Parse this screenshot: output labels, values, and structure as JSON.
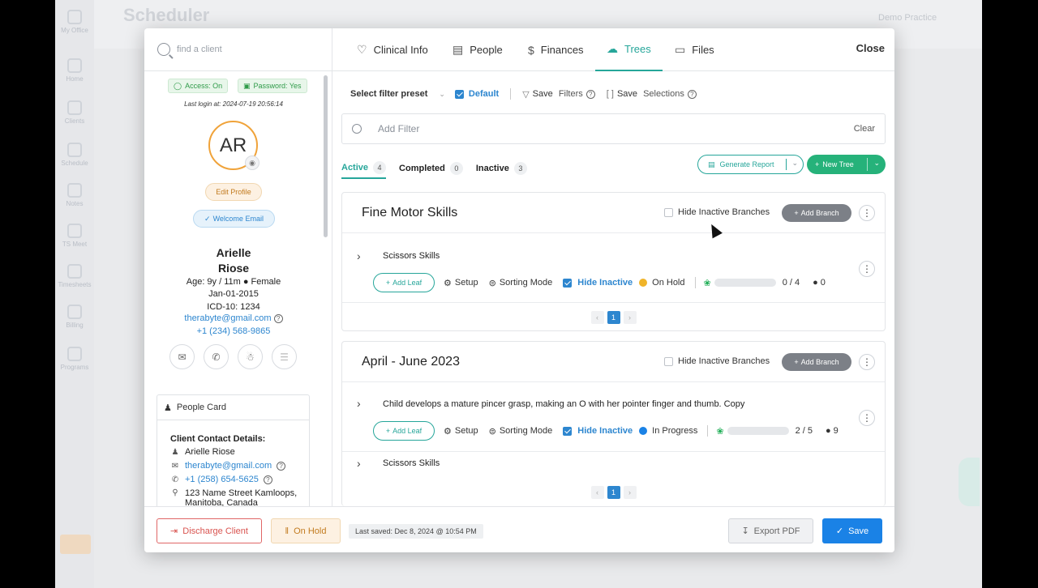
{
  "background": {
    "app_title": "Scheduler",
    "my_office": "My Office",
    "nav": [
      "Home",
      "Clients",
      "Schedule",
      "Notes",
      "TS Meet",
      "Timesheets",
      "Billing",
      "Programs"
    ],
    "practice": "Demo Practice"
  },
  "search": {
    "placeholder": "find a client"
  },
  "tabs": [
    {
      "label": "Clinical Info",
      "icon": "heart-icon"
    },
    {
      "label": "People",
      "icon": "id-card-icon"
    },
    {
      "label": "Finances",
      "icon": "dollar-icon"
    },
    {
      "label": "Trees",
      "icon": "tree-icon"
    },
    {
      "label": "Files",
      "icon": "folder-icon"
    }
  ],
  "close_label": "Close",
  "client": {
    "access": "Access: On",
    "password": "Password: Yes",
    "last_login": "Last login at: 2024-07-19 20:56:14",
    "initials": "AR",
    "edit_profile": "Edit Profile",
    "welcome_email": "Welcome Email",
    "first_name": "Arielle",
    "last_name": "Riose",
    "age_gender": "Age: 9y / 11m ● Female",
    "dob": "Jan-01-2015",
    "icd": "ICD-10: 1234",
    "email": "therabyte@gmail.com",
    "phone": "+1 (234) 568-9865"
  },
  "people_card": {
    "title": "People Card",
    "contact_title": "Client Contact Details:",
    "name": "Arielle Riose",
    "email": "therabyte@gmail.com",
    "phone": "+1 (258) 654-5625",
    "address": "123 Name Street Kamloops,",
    "address2": "Manitoba, Canada"
  },
  "filters": {
    "preset_label": "Select filter preset",
    "default_label": "Default",
    "save_label": "Save",
    "filters_label": "Filters",
    "selections_label": "Selections",
    "add_filter_placeholder": "Add Filter",
    "clear_label": "Clear"
  },
  "subtabs": [
    {
      "label": "Active",
      "count": "4"
    },
    {
      "label": "Completed",
      "count": "0"
    },
    {
      "label": "Inactive",
      "count": "3"
    }
  ],
  "actions": {
    "generate_report": "Generate Report",
    "new_tree": "New Tree"
  },
  "trees": [
    {
      "title": "Fine Motor Skills",
      "hide_inactive_branches": "Hide Inactive Branches",
      "add_branch": "Add Branch",
      "branch": {
        "name": "Scissors Skills",
        "add_leaf": "Add Leaf",
        "setup": "Setup",
        "sorting_mode": "Sorting Mode",
        "hide_inactive": "Hide Inactive",
        "status": "On Hold",
        "status_color": "#f0b429",
        "progress": 0,
        "ratio": "0 / 4",
        "comments": "0"
      },
      "page": "1"
    },
    {
      "title": "April - June 2023",
      "hide_inactive_branches": "Hide Inactive Branches",
      "add_branch": "Add Branch",
      "branch": {
        "name": "Child develops a mature pincer grasp, making an O with her pointer finger and thumb. Copy",
        "add_leaf": "Add Leaf",
        "setup": "Setup",
        "sorting_mode": "Sorting Mode",
        "hide_inactive": "Hide Inactive",
        "status": "In Progress",
        "status_color": "#1a82e6",
        "progress": 0.4,
        "ratio": "2 / 5",
        "comments": "9"
      },
      "next_branch": "Scissors Skills",
      "page": "1"
    }
  ],
  "footer": {
    "discharge": "Discharge Client",
    "on_hold": "On Hold",
    "last_saved": "Last saved: Dec 8, 2024 @ 10:54 PM",
    "export_pdf": "Export PDF",
    "save": "Save"
  },
  "colors": {
    "accent": "#26a69a",
    "primary": "#1a82e6",
    "danger": "#d9534f",
    "warning": "#c27b1f",
    "success": "#1fae56"
  }
}
